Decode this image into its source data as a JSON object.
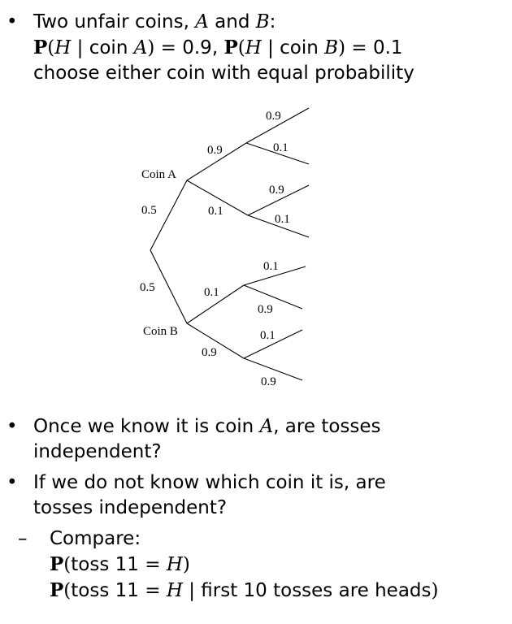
{
  "bullet1": {
    "line1": {
      "a": "Two unfair coins, ",
      "b": "A",
      "c": " and ",
      "d": "B",
      "e": ":"
    },
    "line2": {
      "p1": "P",
      "lp1": "(",
      "h1": "H",
      "mid1": " | coin ",
      "a": "A",
      "rp1": ")",
      "eq1": " = ",
      "v1": "0.9",
      "comma": ", ",
      "p2": "P",
      "lp2": "(",
      "h2": "H",
      "mid2": " | coin ",
      "b": "B",
      "rp2": ")",
      "eq2": " = ",
      "v2": "0.1"
    },
    "line3": "choose either coin with equal probability"
  },
  "tree": {
    "root_top_prob": "0.5",
    "root_bottom_prob": "0.5",
    "coin_a": {
      "label": "Coin A",
      "first_h": "0.9",
      "first_t": "0.1",
      "h_then_h": "0.9",
      "h_then_t": "0.1",
      "t_then_h": "0.9",
      "t_then_t": "0.1"
    },
    "coin_b": {
      "label": "Coin B",
      "first_h": "0.1",
      "first_t": "0.9",
      "h_then_h": "0.1",
      "h_then_t": "0.9",
      "t_then_h": "0.1",
      "t_then_t": "0.9"
    }
  },
  "bullet2": {
    "l1a": "Once we know it is coin ",
    "l1b": "A",
    "l1c": ", are tosses",
    "l2": "independent?"
  },
  "bullet3": {
    "l1": "If we do not know which coin it is, are",
    "l2": "tosses independent?"
  },
  "sub": {
    "label": "Compare:",
    "expr1": {
      "p": "P",
      "lp": "(",
      "txt": "toss 11",
      "eq": " = ",
      "h": "H",
      "rp": ")"
    },
    "expr2": {
      "p": "P",
      "lp": "(",
      "txt": "toss 11",
      "eq": " = ",
      "h": "H",
      "bar": " | ",
      "cond": "first 10 tosses are heads",
      "rp": ")"
    }
  }
}
